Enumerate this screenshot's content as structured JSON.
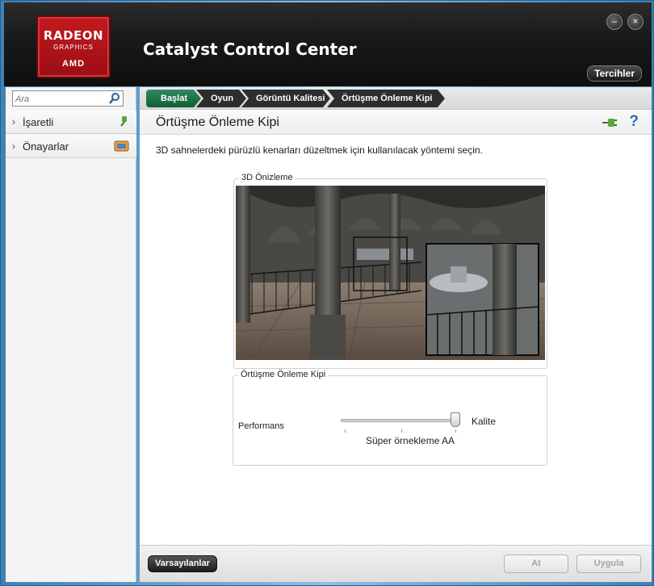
{
  "window": {
    "title": "Catalyst Control Center"
  },
  "logo": {
    "line1": "RADEON",
    "line2": "GRAPHICS",
    "line3": "AMD"
  },
  "header": {
    "preferences_label": "Tercihler",
    "minimize_glyph": "–",
    "close_glyph": "×"
  },
  "sidebar": {
    "search_placeholder": "Ara",
    "items": [
      {
        "label": "İşaretli",
        "icon": "pin-icon"
      },
      {
        "label": "Önayarlar",
        "icon": "presets-icon"
      }
    ]
  },
  "breadcrumb": [
    "Başlat",
    "Oyun",
    "Görüntü Kalitesi",
    "Örtüşme Önleme Kipi"
  ],
  "page": {
    "title": "Örtüşme Önleme Kipi",
    "description": "3D sahnelerdeki pürüzlü kenarları düzeltmek için kullanılacak yöntemi seçin."
  },
  "preview": {
    "label": "3D Önizleme"
  },
  "aa_mode": {
    "label": "Örtüşme Önleme Kipi",
    "min_label": "Performans",
    "max_label": "Kalite",
    "value_label": "Süper örnekleme AA",
    "slider_fraction": 1.0
  },
  "footer": {
    "defaults_label": "Varsayılanlar",
    "discard_label": "At",
    "apply_label": "Uygula"
  },
  "colors": {
    "breadcrumb_active": "#1f7a4c",
    "logo_red": "#c41a1f",
    "help_blue": "#2a6db5"
  }
}
